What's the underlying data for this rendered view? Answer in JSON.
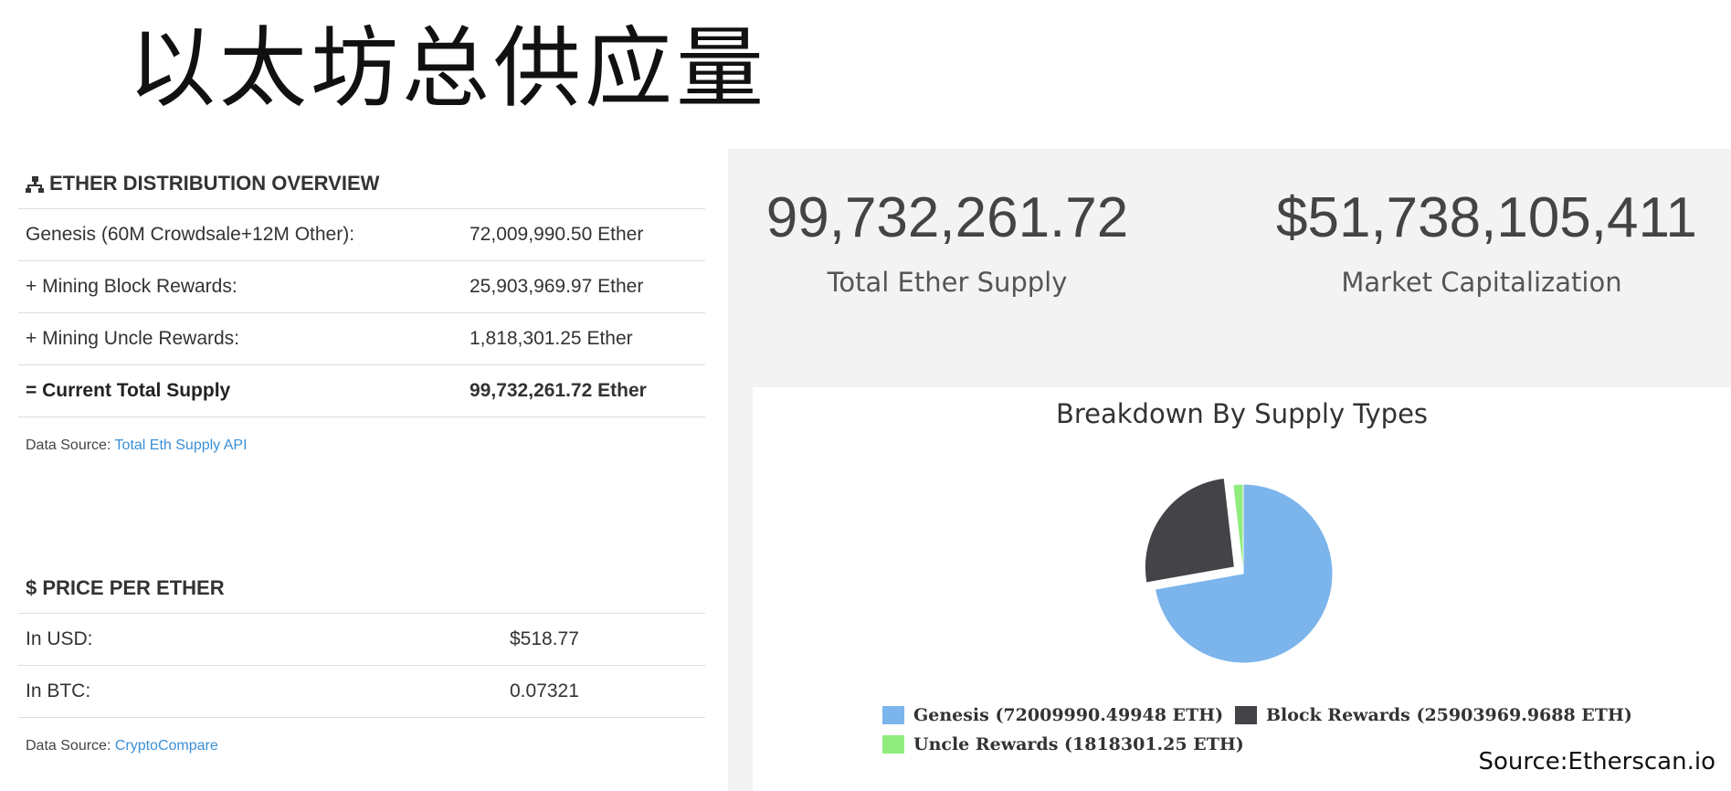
{
  "slide_title": "以太坊总供应量",
  "distribution": {
    "heading": "ETHER DISTRIBUTION OVERVIEW",
    "rows": [
      {
        "label": "Genesis (60M Crowdsale+12M Other):",
        "value": "72,009,990.50 Ether"
      },
      {
        "label": "+ Mining Block Rewards:",
        "value": "25,903,969.97 Ether"
      },
      {
        "label": "+ Mining Uncle Rewards:",
        "value": "1,818,301.25 Ether"
      },
      {
        "label": "= Current Total Supply",
        "value": "99,732,261.72 Ether"
      }
    ],
    "source_prefix": "Data Source: ",
    "source_link": "Total Eth Supply API"
  },
  "price": {
    "heading": "$ PRICE PER ETHER",
    "rows": [
      {
        "label": "In USD:",
        "value": "$518.77"
      },
      {
        "label": "In BTC:",
        "value": "0.07321"
      }
    ],
    "source_prefix": "Data Source: ",
    "source_link": "CryptoCompare"
  },
  "stats": {
    "total_supply": {
      "value": "99,732,261.72",
      "caption": "Total Ether Supply"
    },
    "market_cap": {
      "value": "$51,738,105,411",
      "caption": "Market Capitalization"
    }
  },
  "chart_data": {
    "type": "pie",
    "title": "Breakdown By Supply Types",
    "slices": [
      {
        "name": "Genesis",
        "value": 72009990.49948,
        "color": "#7cb5ec",
        "legend": "Genesis (72009990.49948 ETH)"
      },
      {
        "name": "Block Rewards",
        "value": 25903969.9688,
        "color": "#434348",
        "legend": "Block Rewards (25903969.9688 ETH)",
        "exploded": true
      },
      {
        "name": "Uncle Rewards",
        "value": 1818301.25,
        "color": "#90ed7d",
        "legend": "Uncle Rewards (1818301.25 ETH)"
      }
    ]
  },
  "source_credit": "Source:Etherscan.io"
}
